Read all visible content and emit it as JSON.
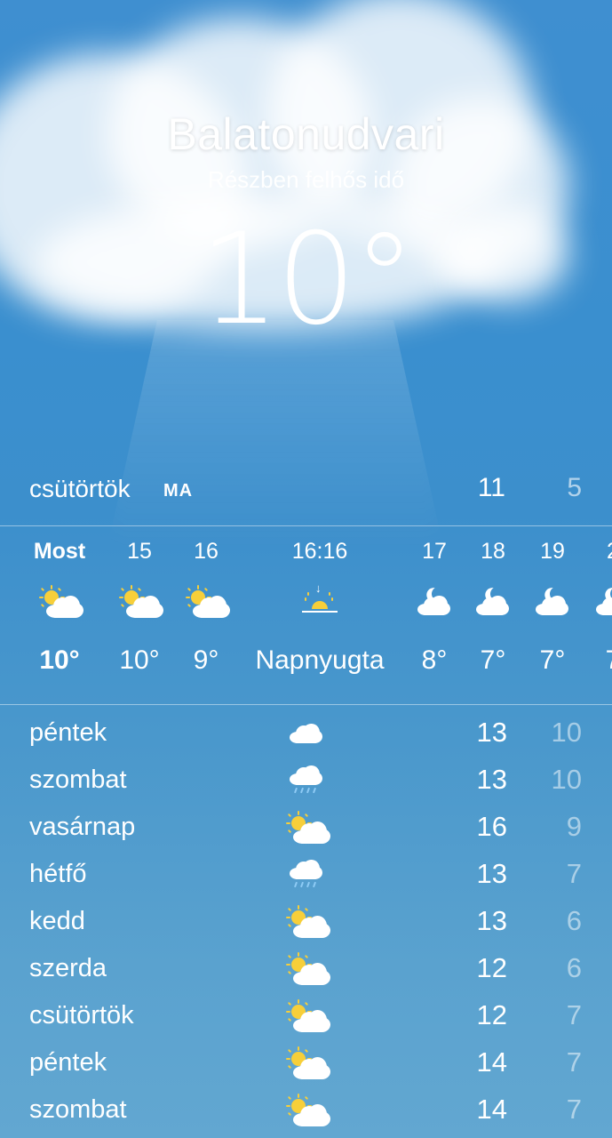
{
  "location": {
    "city": "Balatonudvari",
    "condition": "Részben felhős idő",
    "temperature": "10°"
  },
  "today": {
    "day": "csütörtök",
    "badge": "MA",
    "high": "11",
    "low": "5"
  },
  "hourly": [
    {
      "time": "Most",
      "icon": "partly-cloudy-day-icon",
      "temp": "10°"
    },
    {
      "time": "15",
      "icon": "partly-cloudy-day-icon",
      "temp": "10°"
    },
    {
      "time": "16",
      "icon": "partly-cloudy-day-icon",
      "temp": "9°"
    },
    {
      "time": "16:16",
      "icon": "sunset-icon",
      "temp": "Napnyugta"
    },
    {
      "time": "17",
      "icon": "partly-cloudy-night-icon",
      "temp": "8°"
    },
    {
      "time": "18",
      "icon": "partly-cloudy-night-icon",
      "temp": "7°"
    },
    {
      "time": "19",
      "icon": "partly-cloudy-night-icon",
      "temp": "7°"
    },
    {
      "time": "2",
      "icon": "partly-cloudy-night-icon",
      "temp": "7"
    }
  ],
  "daily": [
    {
      "day": "péntek",
      "icon": "cloud-icon",
      "high": "13",
      "low": "10"
    },
    {
      "day": "szombat",
      "icon": "rain-icon",
      "high": "13",
      "low": "10"
    },
    {
      "day": "vasárnap",
      "icon": "partly-cloudy-day-icon",
      "high": "16",
      "low": "9"
    },
    {
      "day": "hétfő",
      "icon": "rain-icon",
      "high": "13",
      "low": "7"
    },
    {
      "day": "kedd",
      "icon": "partly-cloudy-day-icon",
      "high": "13",
      "low": "6"
    },
    {
      "day": "szerda",
      "icon": "partly-cloudy-day-icon",
      "high": "12",
      "low": "6"
    },
    {
      "day": "csütörtök",
      "icon": "partly-cloudy-day-icon",
      "high": "12",
      "low": "7"
    },
    {
      "day": "péntek",
      "icon": "partly-cloudy-day-icon",
      "high": "14",
      "low": "7"
    },
    {
      "day": "szombat",
      "icon": "partly-cloudy-day-icon",
      "high": "14",
      "low": "7"
    }
  ],
  "colors": {
    "sky_top": "#3f8fd0",
    "sky_bottom": "#62a7d1",
    "sun": "#f7cf3a",
    "low_text": "rgba(255,255,255,0.5)"
  }
}
